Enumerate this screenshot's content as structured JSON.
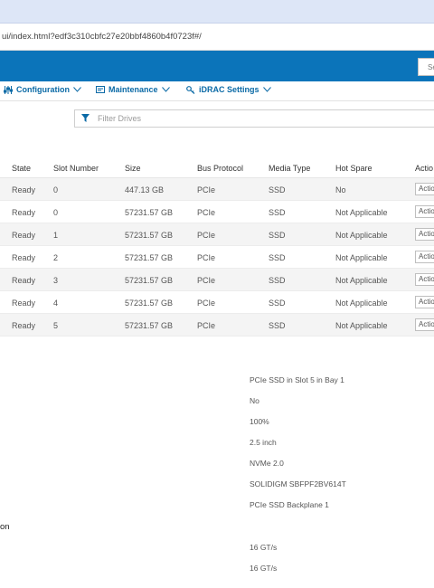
{
  "browser": {
    "url": "ui/index.html?edf3c310cbfc27e20bbf4860b4f0723f#/"
  },
  "header": {
    "search_placeholder": "Se"
  },
  "menu": {
    "configuration": "Configuration",
    "maintenance": "Maintenance",
    "idrac_settings": "iDRAC Settings"
  },
  "filter": {
    "placeholder": "Filter Drives"
  },
  "table": {
    "headers": {
      "state": "State",
      "slot": "Slot Number",
      "size": "Size",
      "bus": "Bus Protocol",
      "media": "Media Type",
      "spare": "Hot Spare",
      "actions": "Actio"
    },
    "rows": [
      {
        "state": "Ready",
        "slot": "0",
        "size": "447.13 GB",
        "bus": "PCIe",
        "media": "SSD",
        "spare": "No",
        "action": "Actio"
      },
      {
        "state": "Ready",
        "slot": "0",
        "size": "57231.57 GB",
        "bus": "PCIe",
        "media": "SSD",
        "spare": "Not Applicable",
        "action": "Actio"
      },
      {
        "state": "Ready",
        "slot": "1",
        "size": "57231.57 GB",
        "bus": "PCIe",
        "media": "SSD",
        "spare": "Not Applicable",
        "action": "Actio"
      },
      {
        "state": "Ready",
        "slot": "2",
        "size": "57231.57 GB",
        "bus": "PCIe",
        "media": "SSD",
        "spare": "Not Applicable",
        "action": "Actio"
      },
      {
        "state": "Ready",
        "slot": "3",
        "size": "57231.57 GB",
        "bus": "PCIe",
        "media": "SSD",
        "spare": "Not Applicable",
        "action": "Actio"
      },
      {
        "state": "Ready",
        "slot": "4",
        "size": "57231.57 GB",
        "bus": "PCIe",
        "media": "SSD",
        "spare": "Not Applicable",
        "action": "Actio"
      },
      {
        "state": "Ready",
        "slot": "5",
        "size": "57231.57 GB",
        "bus": "PCIe",
        "media": "SSD",
        "spare": "Not Applicable",
        "action": "Actio"
      }
    ]
  },
  "details": {
    "values": [
      "PCIe SSD in Slot 5 in Bay 1",
      "No",
      "100%",
      "2.5 inch",
      "NVMe 2.0",
      "SOLIDIGM SBFPF2BV614T",
      "PCIe SSD Backplane 1"
    ],
    "section_label": "on",
    "link_values": [
      "16 GT/s",
      "16 GT/s"
    ]
  },
  "colors": {
    "header_blue": "#0b74ba",
    "menu_text": "#0b6aa6",
    "browser_chrome": "#dde6f7"
  }
}
